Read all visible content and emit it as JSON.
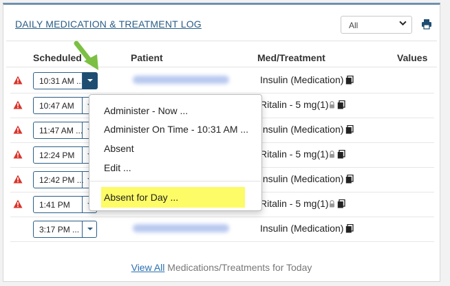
{
  "header": {
    "title": "DAILY MEDICATION & TREATMENT LOG",
    "filter_value": "All"
  },
  "columns": {
    "scheduled": "Scheduled",
    "patient": "Patient",
    "med_treatment": "Med/Treatment",
    "values": "Values"
  },
  "rows": [
    {
      "time": "10:31 AM ...",
      "med": "Insulin (Medication)",
      "warning": true,
      "locked": false
    },
    {
      "time": "10:47 AM",
      "med": "Ritalin - 5 mg(1)",
      "warning": true,
      "locked": true
    },
    {
      "time": "11:47 AM ...",
      "med": "Insulin (Medication)",
      "warning": true,
      "locked": false
    },
    {
      "time": "12:24 PM",
      "med": "Ritalin - 5 mg(1)",
      "warning": true,
      "locked": true
    },
    {
      "time": "12:42 PM ...",
      "med": "Insulin (Medication)",
      "warning": true,
      "locked": false
    },
    {
      "time": "1:41 PM",
      "med": "Ritalin - 5 mg(1)",
      "warning": true,
      "locked": true
    },
    {
      "time": "3:17 PM ...",
      "med": "Insulin (Medication)",
      "warning": false,
      "locked": false
    }
  ],
  "menu": {
    "items": [
      "Administer - Now ...",
      "Administer On Time - 10:31 AM ...",
      "Absent",
      "Edit ..."
    ],
    "highlighted": "Absent for Day ..."
  },
  "footer": {
    "link": "View All",
    "text": " Medications/Treatments for Today"
  },
  "colors": {
    "accent": "#2a5d86",
    "warning": "#d9342b",
    "highlight": "#fdfb66",
    "arrow": "#7bc043"
  }
}
